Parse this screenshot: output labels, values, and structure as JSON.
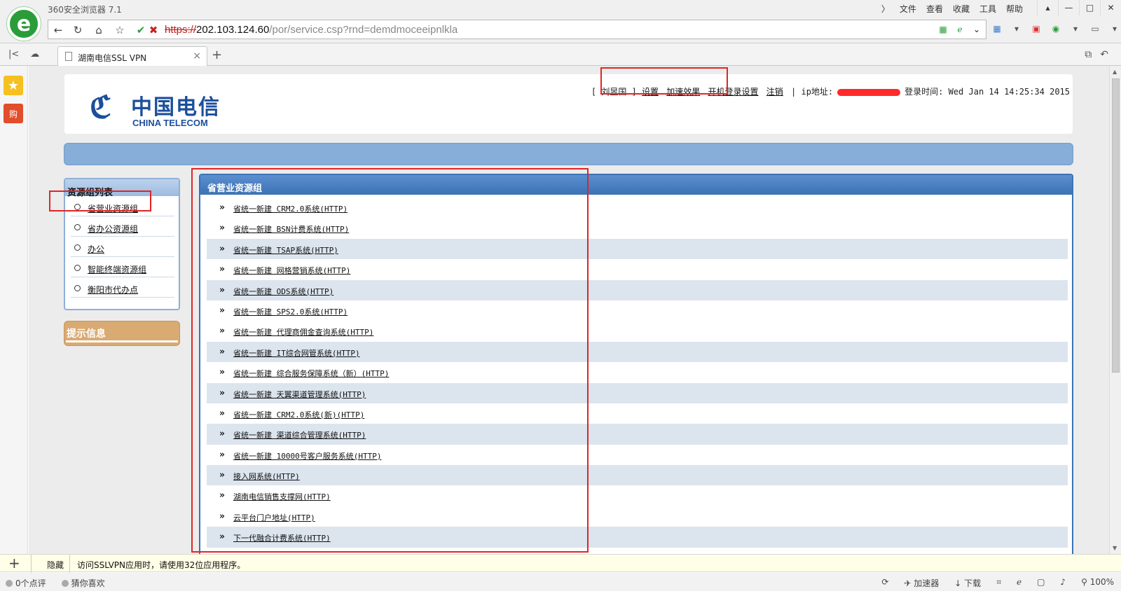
{
  "browser": {
    "app_title": "360安全浏览器 7.1",
    "menu": [
      "文件",
      "查看",
      "收藏",
      "工具",
      "帮助"
    ],
    "url": {
      "scheme": "https://",
      "host": "202.103.124.60",
      "rest": "/por/service.csp?rnd=demdmoceeipnlkla"
    },
    "tab_label": "湖南电信SSL VPN"
  },
  "header": {
    "logo_cn": "中国电信",
    "logo_en": "CHINA TELECOM",
    "user_bar": {
      "user_bracket": "[ 刘昱国 ]",
      "settings": "设置",
      "speedup": "加速效果",
      "startup_login": "开机登录设置",
      "logout": "注销",
      "ip_label": "| ip地址:",
      "login_time_label": "登录时间:",
      "login_time": "Wed Jan 14 14:25:34 2015"
    }
  },
  "sidebar": {
    "title": "资源组列表",
    "items": [
      "省营业资源组",
      "省办公资源组",
      "办公",
      "智能终端资源组",
      "衡阳市代办点"
    ],
    "tip_title": "提示信息"
  },
  "main": {
    "title": "省营业资源组",
    "items": [
      "省统一新建 CRM2.0系统(HTTP)",
      "省统一新建 BSN计费系统(HTTP)",
      "省统一新建 TSAP系统(HTTP)",
      "省统一新建 网格营销系统(HTTP)",
      "省统一新建 ODS系统(HTTP)",
      "省统一新建 SPS2.0系统(HTTP)",
      "省统一新建 代理商佣金查询系统(HTTP)",
      "省统一新建 IT综合网管系统(HTTP)",
      "省统一新建 综合服务保障系统（新）(HTTP)",
      "省统一新建 天翼渠道管理系统(HTTP)",
      "省统一新建 CRM2.0系统(新)(HTTP)",
      "省统一新建 渠道综合管理系统(HTTP)",
      "省统一新建 10000号客户服务系统(HTTP)",
      "接入网系统(HTTP)",
      "湖南电信销售支撑网(HTTP)",
      "云平台门户地址(HTTP)",
      "下一代融合计费系统(HTTP)"
    ]
  },
  "notice": {
    "hide_label": "隐藏",
    "text": "访问SSLVPN应用时，请使用32位应用程序。"
  },
  "status": {
    "comments": "0个点评",
    "guess": "猜你喜欢",
    "accelerator": "加速器",
    "download": "下载",
    "zoom": "100%"
  },
  "colors": {
    "accent_blue": "#3c72b5",
    "highlight_red": "#e02525",
    "logo_blue": "#1c4f9b"
  }
}
